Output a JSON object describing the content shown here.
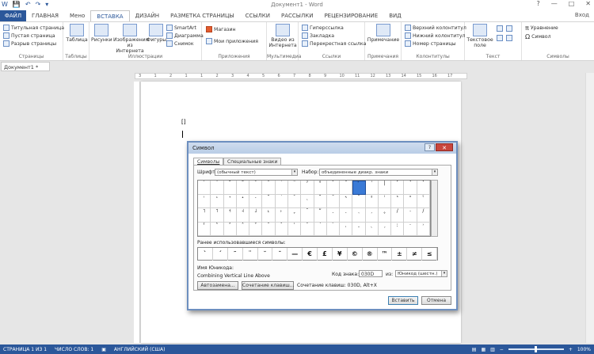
{
  "window": {
    "title": "Документ1 - Word",
    "controls": [
      "?",
      "—",
      "□",
      "✕"
    ]
  },
  "qat": [
    "W",
    "💾",
    "↶",
    "↷",
    "▾"
  ],
  "tabs": [
    "ФАЙЛ",
    "ГЛАВНАЯ",
    "Мено",
    "ВСТАВКА",
    "ДИЗАЙН",
    "РАЗМЕТКА СТРАНИЦЫ",
    "ССЫЛКИ",
    "РАССЫЛКИ",
    "РЕЦЕНЗИРОВАНИЕ",
    "ВИД"
  ],
  "signin": "Вход",
  "ribbon": {
    "pages": {
      "items": [
        "Титульная страница",
        "Пустая страница",
        "Разрыв страницы"
      ],
      "label": "Страницы"
    },
    "tables": {
      "btn": "Таблица",
      "label": "Таблицы"
    },
    "illustrations": {
      "pictures": "Рисунки",
      "online1": "Изображения",
      "online2": "из Интернета",
      "shapes": "Фигуры",
      "smartart": "SmartArt",
      "chart": "Диаграмма",
      "screenshot": "Снимок",
      "label": "Иллюстрации"
    },
    "apps": {
      "store": "Магазин",
      "myapps": "Мои приложения",
      "label": "Приложения"
    },
    "media": {
      "video1": "Видео из",
      "video2": "Интернета",
      "label": "Мультимедиа"
    },
    "links": {
      "items": [
        "Гиперссылка",
        "Закладка",
        "Перекрестная ссылка"
      ],
      "label": "Ссылки"
    },
    "comments": {
      "btn": "Примечание",
      "label": "Примечания"
    },
    "hf": {
      "items": [
        "Верхний колонтитул",
        "Нижний колонтитул",
        "Номер страницы"
      ],
      "label": "Колонтитулы"
    },
    "text": {
      "btn1": "Текстовое",
      "btn2": "поле",
      "label": "Текст"
    },
    "symbols": {
      "items": [
        "Уравнение",
        "Символ"
      ],
      "label": "Символы"
    }
  },
  "doctab": "Документ1 *",
  "ruler_marks": [
    "3",
    "1",
    "2",
    "1",
    "1",
    "2",
    "3",
    "4",
    "5",
    "6",
    "7",
    "8",
    "9",
    "10",
    "11",
    "12",
    "13",
    "14",
    "15",
    "16",
    "17"
  ],
  "page_mark": "[]",
  "status": {
    "page": "СТРАНИЦА 1 ИЗ 1",
    "words": "ЧИСЛО СЛОВ: 1",
    "lang": "АНГЛИЙСКИЙ (США)",
    "zoom": "100%"
  },
  "dialog": {
    "title": "Символ",
    "help": "?",
    "close": "✕",
    "tab_symbols": "Символы",
    "tab_special": "Специальные знаки",
    "font_label": "Шрифт:",
    "font_value": "(обычный текст)",
    "subset_label": "Набор:",
    "subset_value": "объединенные диакр. знаки",
    "grid": [
      "ˋ",
      "ˊ",
      "˘",
      "˜",
      "¯",
      "ˉ",
      "˙",
      "¨",
      "ˀ",
      "°",
      "ˇ",
      "˝",
      "̉",
      "ˈ",
      "|",
      "˹",
      "˺",
      "˺",
      "˓",
      "˔",
      "˕",
      "˖",
      "˗",
      "˘",
      "˙",
      "˚",
      "˛",
      "˜",
      "˝",
      "˞",
      "˟",
      "ˠ",
      "ˡ",
      "ˢ",
      "ˣ",
      "ˤ",
      "˥",
      "˦",
      "˧",
      "˨",
      "˩",
      "˪",
      "˫",
      "ˬ",
      "˭",
      "ˮ",
      "˯",
      "˰",
      "˱",
      "˲",
      "˳",
      "/",
      "˴",
      "/",
      "ˁ",
      "˂",
      "˃",
      "˄",
      "˅",
      "ˆ",
      "ˇ",
      "ˈ",
      "ˉ",
      "ˊ",
      "ˋ",
      "ˌ",
      "ˍ",
      "ˎ",
      "ˏ",
      "ː",
      "ˑ",
      "˒"
    ],
    "recent_label": "Ранее использовавшиеся символы:",
    "recent": [
      "ˋ",
      "ˊ",
      "˜",
      "¨",
      "˘",
      "ˉ",
      "—",
      "€",
      "£",
      "¥",
      "©",
      "®",
      "™",
      "±",
      "≠",
      "≤",
      "≥",
      "÷"
    ],
    "unicode_name_label": "Имя Юникода:",
    "unicode_name": "Combining Vertical Line Above",
    "code_label": "Код знака:",
    "code_value": "030D",
    "from_label": "из:",
    "from_value": "Юникод (шестн.)",
    "autocorrect": "Автозамена...",
    "shortcut_btn": "Сочетание клавиш...",
    "shortcut_text": "Сочетание клавиш: 030D, Alt+X",
    "insert": "Вставить",
    "cancel": "Отмена"
  }
}
